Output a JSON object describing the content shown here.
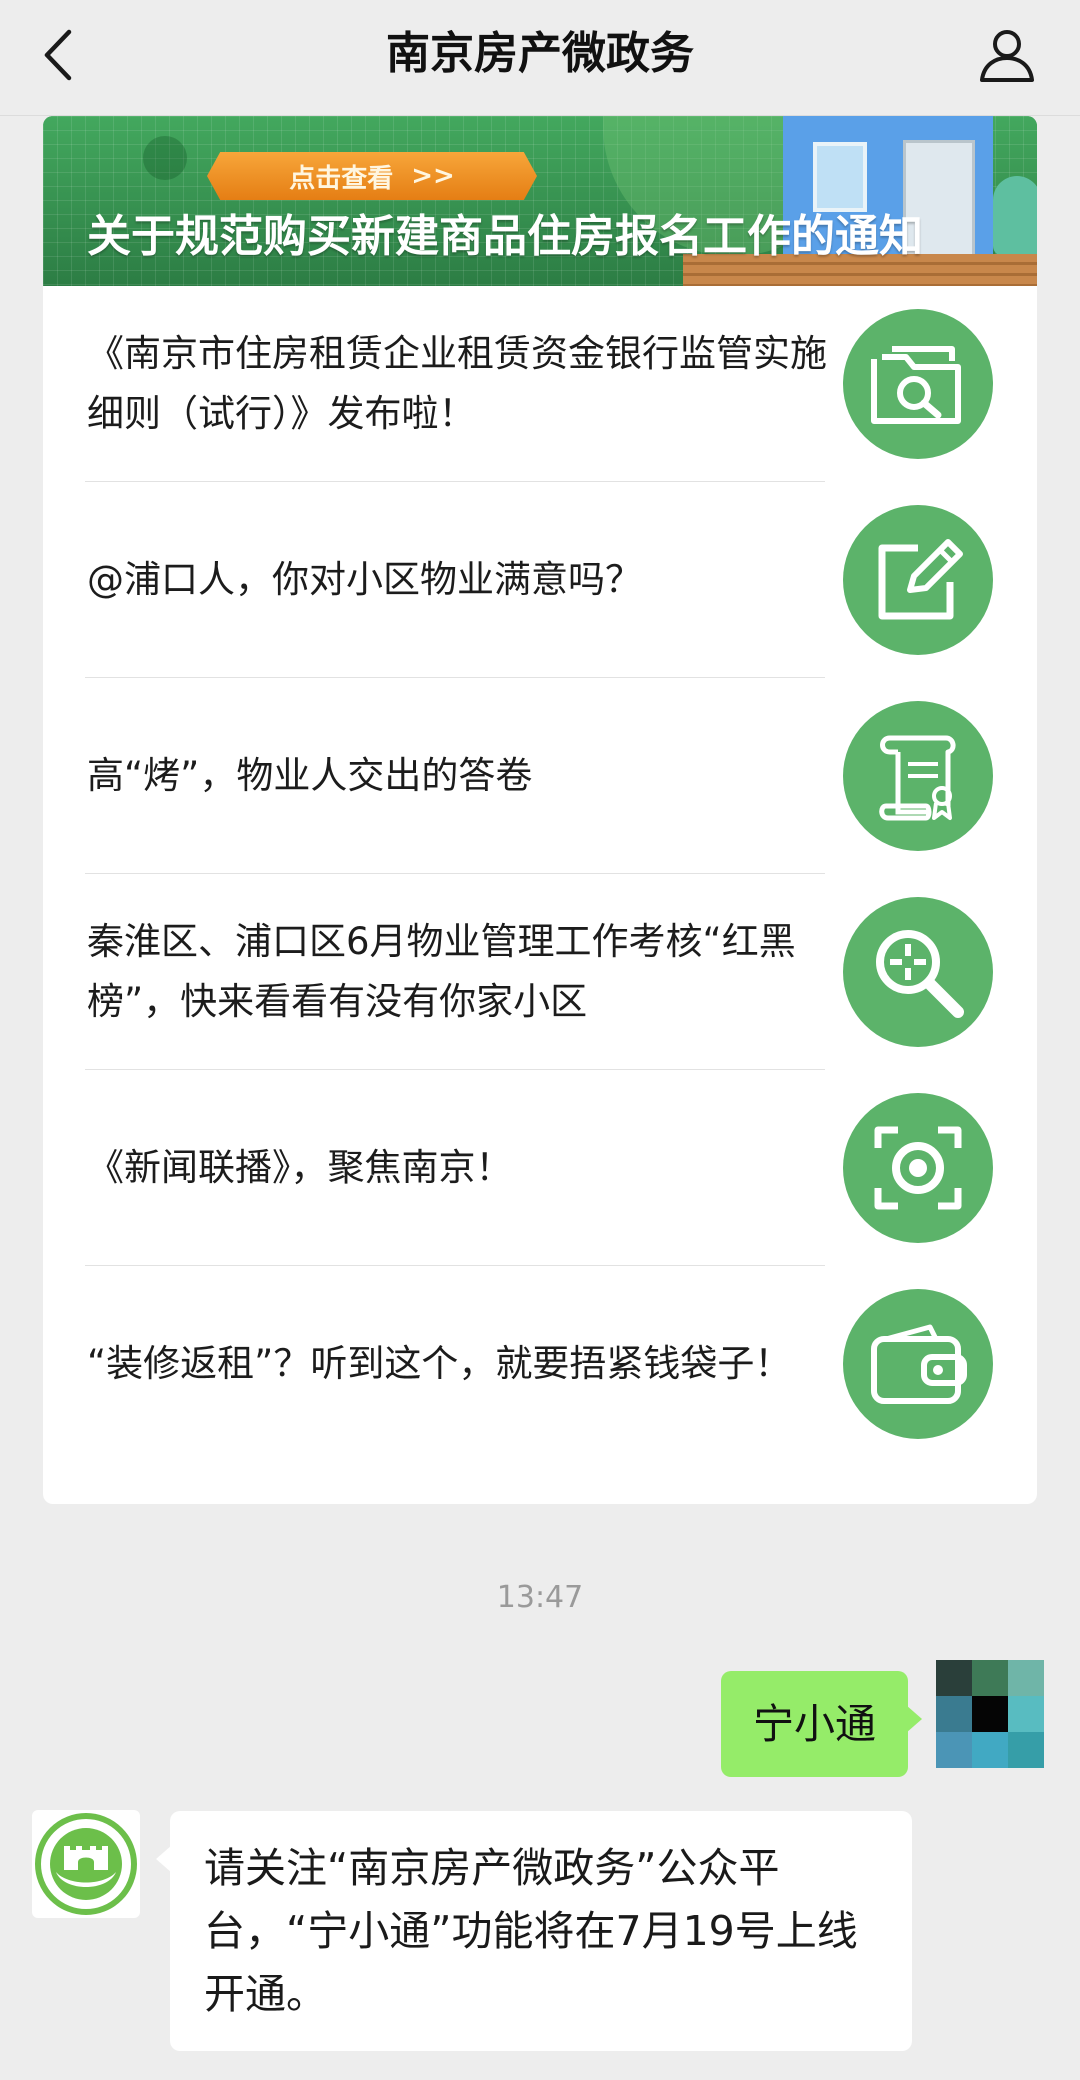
{
  "header": {
    "title": "南京房产微政务",
    "back_icon": "chevron-left-icon",
    "profile_icon": "user-icon"
  },
  "banner": {
    "button_label": "点击查看",
    "button_arrows": ">>",
    "headline": "关于规范购买新建商品住房报名工作的通知"
  },
  "articles": [
    {
      "title": "《南京市住房租赁企业租赁资金银行监管实施细则（试行）》发布啦！",
      "icon": "folder-search-icon"
    },
    {
      "title": "@浦口人，你对小区物业满意吗？",
      "icon": "edit-icon"
    },
    {
      "title": "高“烤”，物业人交出的答卷",
      "icon": "certificate-scroll-icon"
    },
    {
      "title": "秦淮区、浦口区6月物业管理工作考核“红黑榜”，快来看看有没有你家小区",
      "icon": "magnifier-target-icon"
    },
    {
      "title": "《新闻联播》，聚焦南京！",
      "icon": "camera-scan-icon"
    },
    {
      "title": "“装修返租”？听到这个，就要捂紧钱袋子！",
      "icon": "wallet-icon"
    }
  ],
  "chat": {
    "timestamp": "13:47",
    "outgoing": {
      "text": "宁小通"
    },
    "incoming": {
      "text": "请关注“南京房产微政务”公众平台，“宁小通”功能将在7月19号上线开通。"
    }
  },
  "colors": {
    "accent_green": "#5cb36a",
    "bubble_green": "#95ec69",
    "background": "#ededed"
  }
}
